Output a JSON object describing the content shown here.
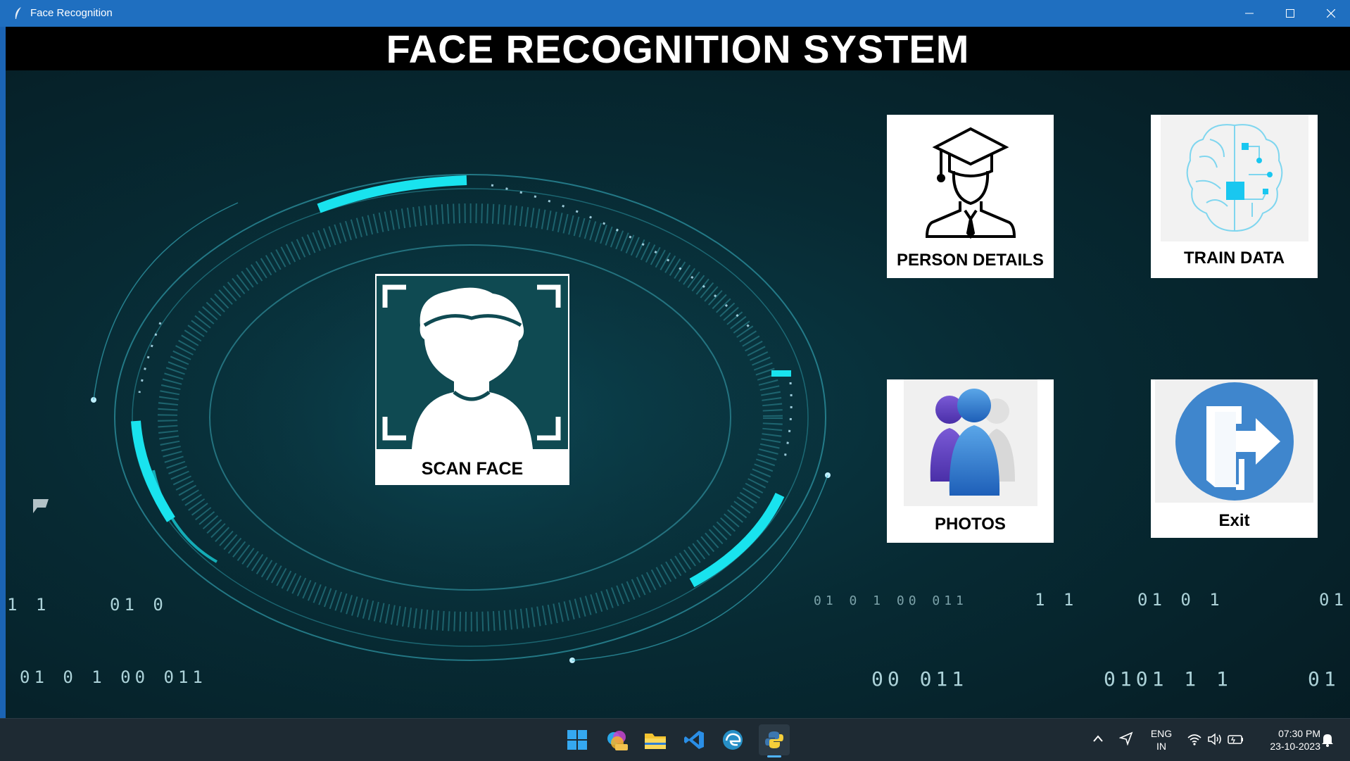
{
  "window": {
    "title": "Face Recognition"
  },
  "header": {
    "title": "FACE RECOGNITION SYSTEM"
  },
  "tiles": {
    "scan_face": "SCAN FACE",
    "person_details": "PERSON DETAILS",
    "train_data": "TRAIN DATA",
    "photos": "PHOTOS",
    "exit": "Exit"
  },
  "binary": [
    "1 1",
    "01 0",
    "01  0  1  00  011",
    "01  0  1  00  011",
    "1 1",
    "01  0  1",
    "01",
    "00  011",
    "0101  1 1",
    "01"
  ],
  "tray": {
    "lang": "ENG",
    "region": "IN",
    "time": "07:30 PM",
    "date": "23-10-2023"
  },
  "colors": {
    "accent": "#1f6fc0",
    "cyan": "#19e3ee",
    "header_bg": "#000000"
  }
}
